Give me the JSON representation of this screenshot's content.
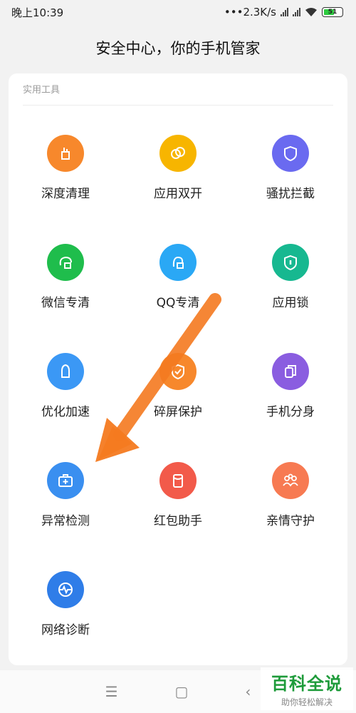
{
  "status": {
    "time": "晚上10:39",
    "network_speed": "2.3K/s",
    "battery": "51"
  },
  "page_title": "安全中心，你的手机管家",
  "section_label": "实用工具",
  "tools": [
    {
      "label": "深度清理",
      "icon": "broom-icon",
      "color": "#f7882c"
    },
    {
      "label": "应用双开",
      "icon": "dual-circle-icon",
      "color": "#f7b500"
    },
    {
      "label": "骚扰拦截",
      "icon": "shield-icon",
      "color": "#6a6af0"
    },
    {
      "label": "微信专清",
      "icon": "wechat-clean-icon",
      "color": "#1fbd4c"
    },
    {
      "label": "QQ专清",
      "icon": "qq-clean-icon",
      "color": "#2aa8f5"
    },
    {
      "label": "应用锁",
      "icon": "lock-shield-icon",
      "color": "#17b890"
    },
    {
      "label": "优化加速",
      "icon": "rocket-icon",
      "color": "#3b98f5"
    },
    {
      "label": "碎屏保护",
      "icon": "screen-shield-icon",
      "color": "#f7882c"
    },
    {
      "label": "手机分身",
      "icon": "phone-clone-icon",
      "color": "#8a5de0"
    },
    {
      "label": "异常检测",
      "icon": "medical-kit-icon",
      "color": "#3a8ff0"
    },
    {
      "label": "红包助手",
      "icon": "red-packet-icon",
      "color": "#f25a4a"
    },
    {
      "label": "亲情守护",
      "icon": "family-icon",
      "color": "#f77a52"
    },
    {
      "label": "网络诊断",
      "icon": "network-pulse-icon",
      "color": "#2f7de8"
    }
  ],
  "nav": {
    "menu": "☰",
    "home": "▢",
    "back": "‹"
  },
  "watermark": {
    "main": "百科全说",
    "sub": "助你轻松解决"
  }
}
